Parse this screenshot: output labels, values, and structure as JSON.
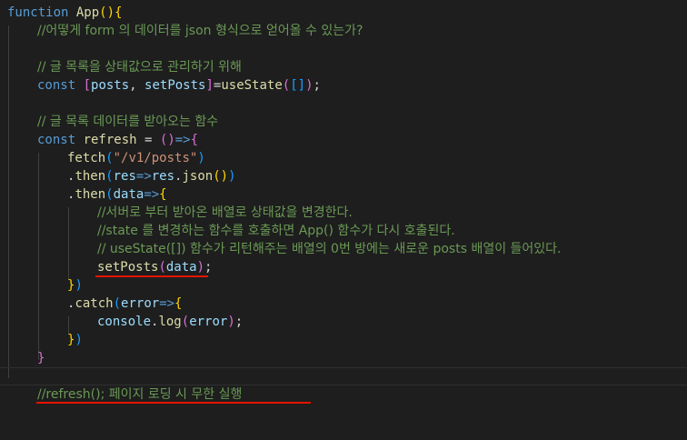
{
  "editor": {
    "lines": [
      [
        [
          "kw",
          "function "
        ],
        [
          "fn",
          "App"
        ],
        [
          "br1",
          "()"
        ],
        [
          "br1",
          "{"
        ]
      ],
      [
        [
          "com",
          "//어떻게 form 의 데이터를 json 형식으로 얻어올 수 있는가?"
        ]
      ],
      [],
      [
        [
          "com",
          "// 글 목록을 상태값으로 관리하기 위해"
        ]
      ],
      [
        [
          "kw",
          "const "
        ],
        [
          "br2",
          "["
        ],
        [
          "var",
          "posts"
        ],
        [
          "punc",
          ", "
        ],
        [
          "var",
          "setPosts"
        ],
        [
          "br2",
          "]"
        ],
        [
          "punc",
          "="
        ],
        [
          "fn",
          "useState"
        ],
        [
          "br2",
          "("
        ],
        [
          "br3",
          "[]"
        ],
        [
          "br2",
          ")"
        ],
        [
          "punc",
          ";"
        ]
      ],
      [],
      [
        [
          "com",
          "// 글 목록 데이터를 받아오는 함수"
        ]
      ],
      [
        [
          "kw",
          "const "
        ],
        [
          "fn",
          "refresh"
        ],
        [
          "punc",
          " = "
        ],
        [
          "br2",
          "()"
        ],
        [
          "kw",
          "=>"
        ],
        [
          "br2",
          "{"
        ]
      ],
      [
        [
          "fn",
          "fetch"
        ],
        [
          "br3",
          "("
        ],
        [
          "str",
          "\"/v1/posts\""
        ],
        [
          "br3",
          ")"
        ]
      ],
      [
        [
          "punc",
          "."
        ],
        [
          "fn",
          "then"
        ],
        [
          "br3",
          "("
        ],
        [
          "var",
          "res"
        ],
        [
          "kw",
          "=>"
        ],
        [
          "var",
          "res"
        ],
        [
          "punc",
          "."
        ],
        [
          "fn",
          "json"
        ],
        [
          "br1",
          "()"
        ],
        [
          "br3",
          ")"
        ]
      ],
      [
        [
          "punc",
          "."
        ],
        [
          "fn",
          "then"
        ],
        [
          "br3",
          "("
        ],
        [
          "var",
          "data"
        ],
        [
          "kw",
          "=>"
        ],
        [
          "br1",
          "{"
        ]
      ],
      [
        [
          "com",
          "//서버로 부터 받아온 배열로 상태값을 변경한다."
        ]
      ],
      [
        [
          "com",
          "//state 를 변경하는 함수를 호출하면 App() 함수가 다시 호출된다."
        ]
      ],
      [
        [
          "com",
          "// useState([]) 함수가 리턴해주는 배열의 0번 방에는 새로운 posts 배열이 들어있다."
        ]
      ],
      [
        [
          "fn",
          "setPosts"
        ],
        [
          "br2",
          "("
        ],
        [
          "var",
          "data"
        ],
        [
          "br2",
          ")"
        ],
        [
          "punc",
          ";"
        ]
      ],
      [
        [
          "br1",
          "}"
        ],
        [
          "br3",
          ")"
        ]
      ],
      [
        [
          "punc",
          "."
        ],
        [
          "fn",
          "catch"
        ],
        [
          "br3",
          "("
        ],
        [
          "var",
          "error"
        ],
        [
          "kw",
          "=>"
        ],
        [
          "br1",
          "{"
        ]
      ],
      [
        [
          "var",
          "console"
        ],
        [
          "punc",
          "."
        ],
        [
          "fn",
          "log"
        ],
        [
          "br2",
          "("
        ],
        [
          "var",
          "error"
        ],
        [
          "br2",
          ")"
        ],
        [
          "punc",
          ";"
        ]
      ],
      [
        [
          "br1",
          "}"
        ],
        [
          "br3",
          ")"
        ]
      ],
      [
        [
          "br2",
          "}"
        ]
      ],
      [],
      [
        [
          "com",
          "//refresh(); 페이지 로딩 시 무한 실행"
        ]
      ]
    ],
    "colors": {
      "background": "#1e1e1e",
      "keyword": "#569cd6",
      "function": "#dcdcaa",
      "variable": "#9cdcfe",
      "string": "#ce9178",
      "comment": "#6a9955",
      "underline": "#e51400"
    }
  }
}
